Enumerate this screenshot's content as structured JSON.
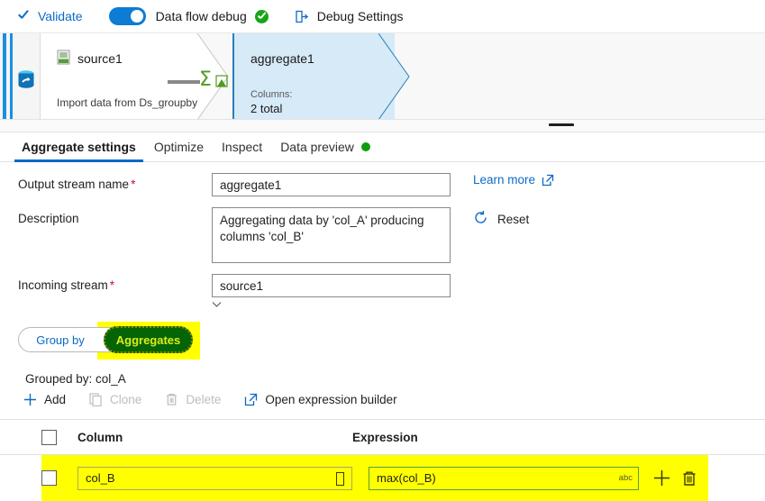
{
  "toolbar": {
    "validate_label": "Validate",
    "data_flow_debug_label": "Data flow debug",
    "debug_settings_label": "Debug Settings",
    "toggle_on": true,
    "accent_color": "#0c7cd5",
    "status_color": "#16a516"
  },
  "canvas": {
    "source_node": {
      "title": "source1",
      "subtitle": "Import data from Ds_groupby"
    },
    "aggregate_node": {
      "title": "aggregate1",
      "columns_label": "Columns:",
      "columns_value": "2 total",
      "fill_color": "#d6eaf8"
    }
  },
  "tabs": [
    {
      "label": "Aggregate settings",
      "active": true
    },
    {
      "label": "Optimize",
      "active": false
    },
    {
      "label": "Inspect",
      "active": false
    },
    {
      "label": "Data preview",
      "active": false,
      "dot_color": "#0f9d0f"
    }
  ],
  "form": {
    "output_stream_name": {
      "label": "Output stream name",
      "required_marker": "*",
      "value": "aggregate1"
    },
    "description": {
      "label": "Description",
      "value": "Aggregating data by 'col_A' producing columns 'col_B'"
    },
    "incoming_stream": {
      "label": "Incoming stream",
      "required_marker": "*",
      "value": "source1"
    }
  },
  "side_links": {
    "learn_more_label": "Learn more",
    "reset_label": "Reset"
  },
  "segmented_control": {
    "group_by_label": "Group by",
    "aggregates_label": "Aggregates",
    "selected": "Aggregates",
    "highlight_color": "#ffff00",
    "selected_fill": "#056405",
    "selected_text_color": "#d8ed1b"
  },
  "grouped_by_text": "Grouped by: col_A",
  "actions": [
    {
      "label": "Add",
      "icon": "plus-icon",
      "enabled": true
    },
    {
      "label": "Clone",
      "icon": "copy-icon",
      "enabled": false
    },
    {
      "label": "Delete",
      "icon": "trash-icon",
      "enabled": false
    },
    {
      "label": "Open expression builder",
      "icon": "external-link-icon",
      "enabled": true
    }
  ],
  "table": {
    "headers": {
      "column": "Column",
      "expression": "Expression"
    },
    "rows": [
      {
        "column": "col_B",
        "expression": "max(col_B)",
        "type_badge": "abc",
        "highlighted": true
      }
    ]
  }
}
